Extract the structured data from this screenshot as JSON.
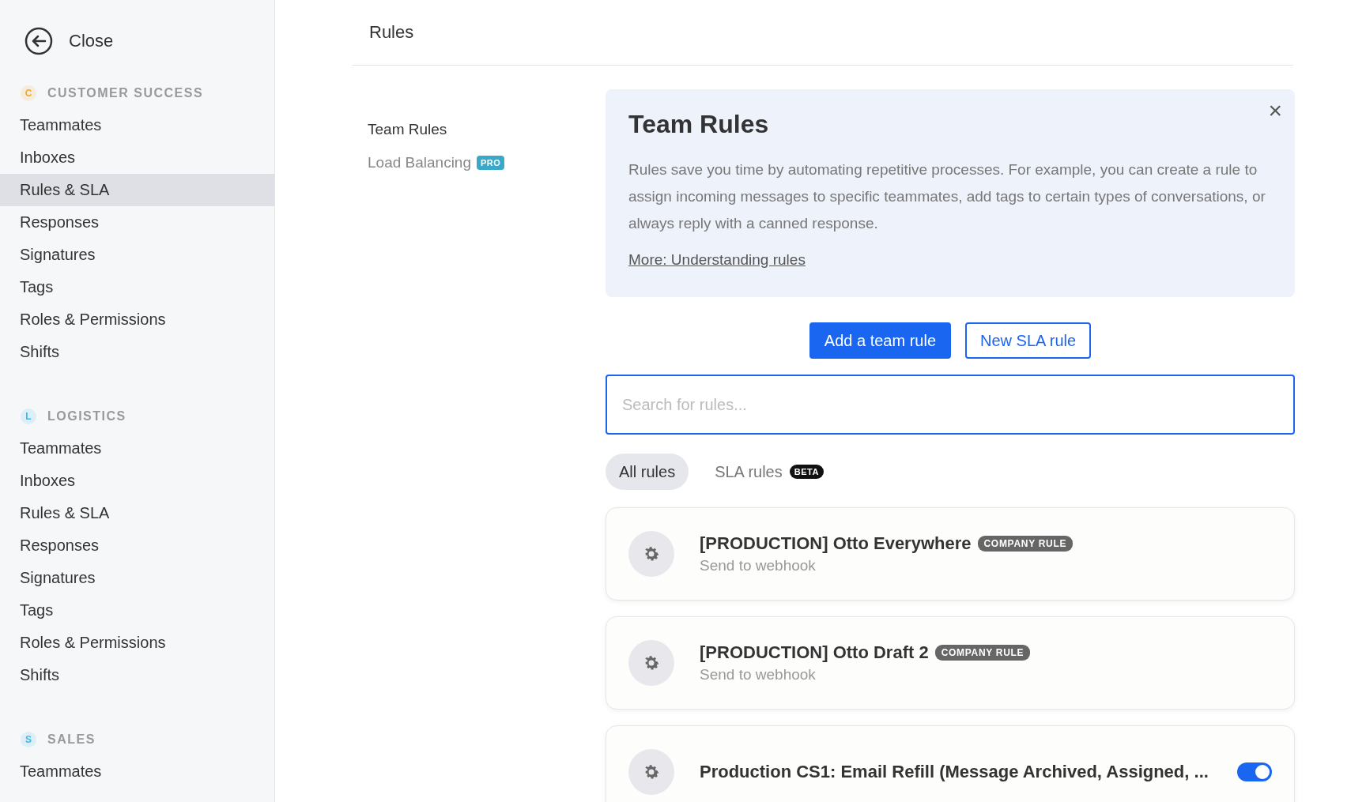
{
  "sidebar": {
    "close_label": "Close",
    "teams": [
      {
        "initial": "C",
        "name": "CUSTOMER SUCCESS",
        "color": "#f5a623",
        "items": [
          {
            "label": "Teammates",
            "selected": false
          },
          {
            "label": "Inboxes",
            "selected": false
          },
          {
            "label": "Rules & SLA",
            "selected": true
          },
          {
            "label": "Responses",
            "selected": false
          },
          {
            "label": "Signatures",
            "selected": false
          },
          {
            "label": "Tags",
            "selected": false
          },
          {
            "label": "Roles & Permissions",
            "selected": false
          },
          {
            "label": "Shifts",
            "selected": false
          }
        ]
      },
      {
        "initial": "L",
        "name": "LOGISTICS",
        "color": "#3db8e8",
        "items": [
          {
            "label": "Teammates",
            "selected": false
          },
          {
            "label": "Inboxes",
            "selected": false
          },
          {
            "label": "Rules & SLA",
            "selected": false
          },
          {
            "label": "Responses",
            "selected": false
          },
          {
            "label": "Signatures",
            "selected": false
          },
          {
            "label": "Tags",
            "selected": false
          },
          {
            "label": "Roles & Permissions",
            "selected": false
          },
          {
            "label": "Shifts",
            "selected": false
          }
        ]
      },
      {
        "initial": "S",
        "name": "SALES",
        "color": "#3db8e8",
        "items": [
          {
            "label": "Teammates",
            "selected": false
          }
        ]
      }
    ]
  },
  "page_title": "Rules",
  "subnav": [
    {
      "label": "Team Rules",
      "selected": true
    },
    {
      "label": "Load Balancing",
      "selected": false,
      "badge": "PRO"
    }
  ],
  "info_card": {
    "title": "Team Rules",
    "body": "Rules save you time by automating repetitive processes. For example, you can create a rule to assign incoming messages to specific teammates, add tags to certain types of conversations, or always reply with a canned response.",
    "link": "More: Understanding rules",
    "close": "×"
  },
  "buttons": [
    {
      "label": "Add a team rule",
      "kind": "primary"
    },
    {
      "label": "New SLA rule",
      "kind": "secondary"
    }
  ],
  "search": {
    "placeholder": "Search for rules..."
  },
  "filter_tabs": [
    {
      "label": "All rules",
      "selected": true
    },
    {
      "label": "SLA rules",
      "selected": false,
      "badge": "BETA"
    }
  ],
  "rules": [
    {
      "title": "[PRODUCTION] Otto Everywhere",
      "badge": "COMPANY RULE",
      "subtitle": "Send to webhook"
    },
    {
      "title": "[PRODUCTION] Otto Draft 2",
      "badge": "COMPANY RULE",
      "subtitle": "Send to webhook"
    },
    {
      "title": "Production CS1: Email Refill (Message Archived, Assigned, ...",
      "on": true
    }
  ]
}
